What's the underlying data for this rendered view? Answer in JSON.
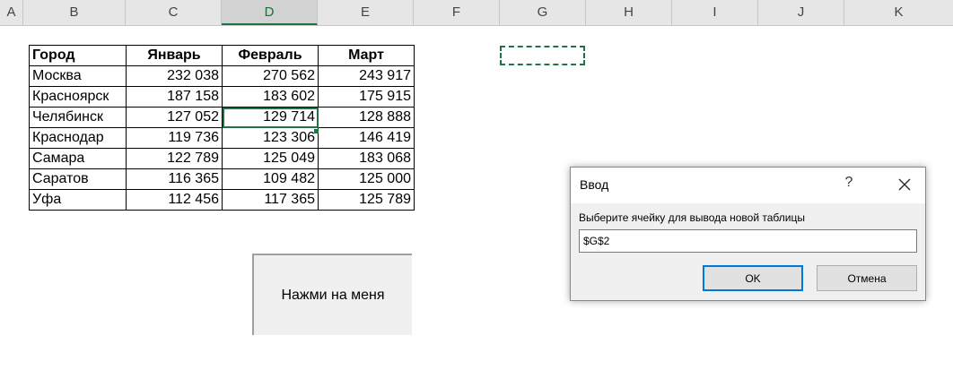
{
  "columns": [
    "A",
    "B",
    "C",
    "D",
    "E",
    "F",
    "G",
    "H",
    "I",
    "J",
    "K"
  ],
  "selected_column": "D",
  "table": {
    "headers": [
      "Город",
      "Январь",
      "Февраль",
      "Март"
    ],
    "rows": [
      [
        "Москва",
        "232 038",
        "270 562",
        "243 917"
      ],
      [
        "Красноярск",
        "187 158",
        "183 602",
        "175 915"
      ],
      [
        "Челябинск",
        "127 052",
        "129 714",
        "128 888"
      ],
      [
        "Краснодар",
        "119 736",
        "123 306",
        "146 419"
      ],
      [
        "Самара",
        "122 789",
        "125 049",
        "183 068"
      ],
      [
        "Саратов",
        "116 365",
        "109 482",
        "125 000"
      ],
      [
        "Уфа",
        "112 456",
        "117 365",
        "125 789"
      ]
    ]
  },
  "macro_button": {
    "label": "Нажми на меня"
  },
  "dialog": {
    "title": "Ввод",
    "help": "?",
    "prompt": "Выберите ячейку для вывода новой таблицы",
    "input_value": "$G$2",
    "ok_label": "OK",
    "cancel_label": "Отмена"
  },
  "colors": {
    "accent": "#217346",
    "focus": "#0078d7"
  }
}
